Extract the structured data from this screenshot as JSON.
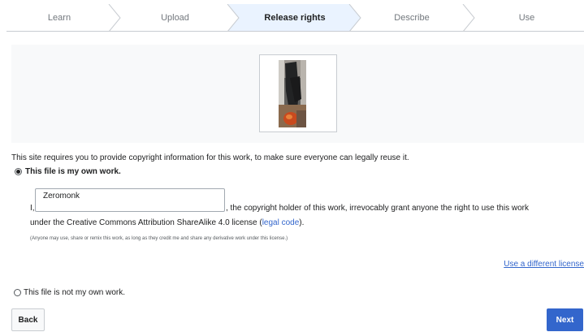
{
  "steps": [
    {
      "label": "Learn",
      "active": false
    },
    {
      "label": "Upload",
      "active": false
    },
    {
      "label": "Release rights",
      "active": true
    },
    {
      "label": "Describe",
      "active": false
    },
    {
      "label": "Use",
      "active": false
    }
  ],
  "intro_text": "This site requires you to provide copyright information for this work, to make sure everyone can legally reuse it.",
  "own_work": {
    "label": "This file is my own work.",
    "selected": true,
    "prefix": "I,",
    "name_value": "Zeromonk",
    "license_text_1": ", the copyright holder of this work, irrevocably grant anyone the right to use this work",
    "license_text_2": "under the Creative Commons Attribution ShareAlike 4.0 license (",
    "legal_code_link": "legal code",
    "license_text_2_end": ").",
    "small_print": "(Anyone may use, share or remix this work, as long as they credit me and share any derivative work under this license.)"
  },
  "different_license_link": "Use a different license",
  "not_own_work": {
    "label": "This file is not my own work.",
    "selected": false
  },
  "buttons": {
    "back": "Back",
    "next": "Next"
  },
  "colors": {
    "accent": "#3366cc",
    "active_step": "#eaf3ff",
    "panel_bg": "#f8f9fa"
  }
}
